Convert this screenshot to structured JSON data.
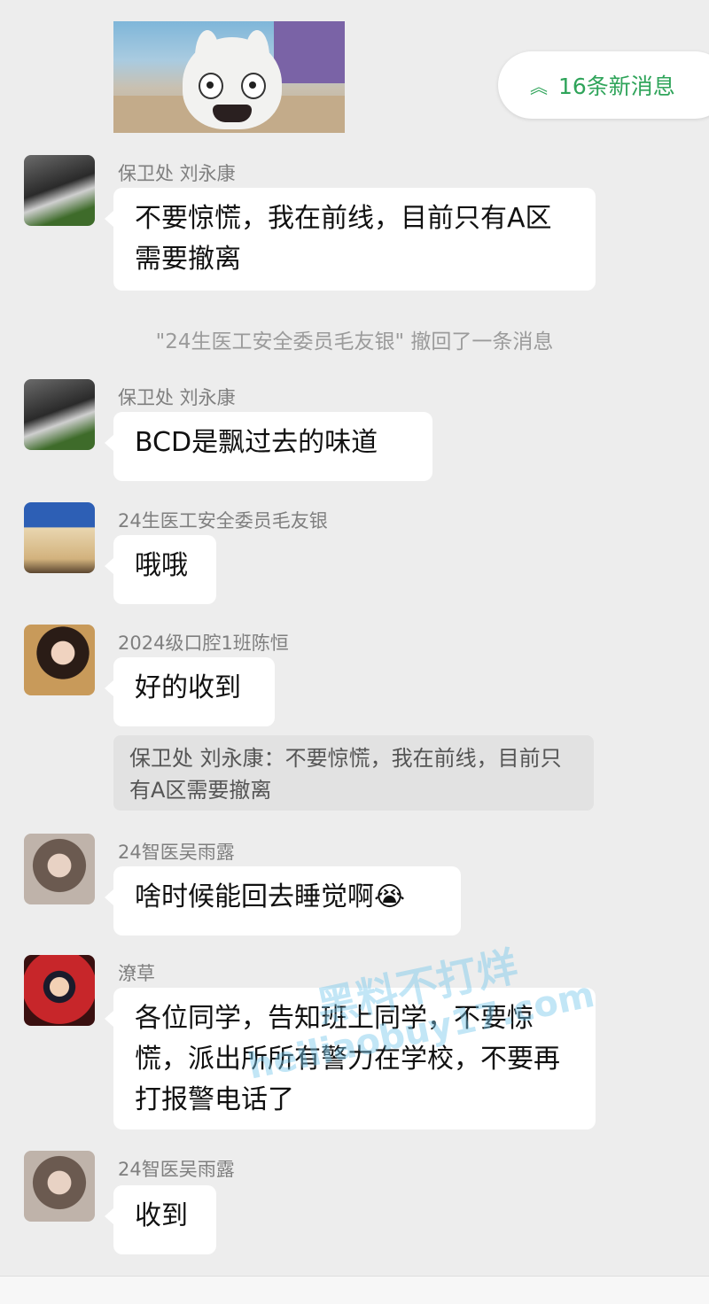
{
  "new_messages": {
    "icon": "double-chevron-up-icon",
    "label": "16条新消息",
    "color": "#2fa45a"
  },
  "recall_notice": "\"24生医工安全委员毛友银\" 撤回了一条消息",
  "messages": [
    {
      "sender": "保卫处  刘永康",
      "text": "不要惊慌，我在前线，目前只有A区需要撤离"
    },
    {
      "sender": "保卫处  刘永康",
      "text": "BCD是飘过去的味道"
    },
    {
      "sender": "24生医工安全委员毛友银",
      "text": "哦哦"
    },
    {
      "sender": "2024级口腔1班陈恒",
      "text": "好的收到",
      "quote": "保卫处  刘永康：不要惊慌，我在前线，目前只有A区需要撤离"
    },
    {
      "sender": "24智医吴雨露",
      "text": "啥时候能回去睡觉啊😭"
    },
    {
      "sender": "潦草",
      "text": "各位同学，告知班上同学，不要惊慌，派出所所有警力在学校，不要再打报警电话了"
    },
    {
      "sender": "24智医吴雨露",
      "text": "收到"
    }
  ],
  "watermark": {
    "line1": "黑料不打烊",
    "line2": "heiliaobuy17.com"
  }
}
